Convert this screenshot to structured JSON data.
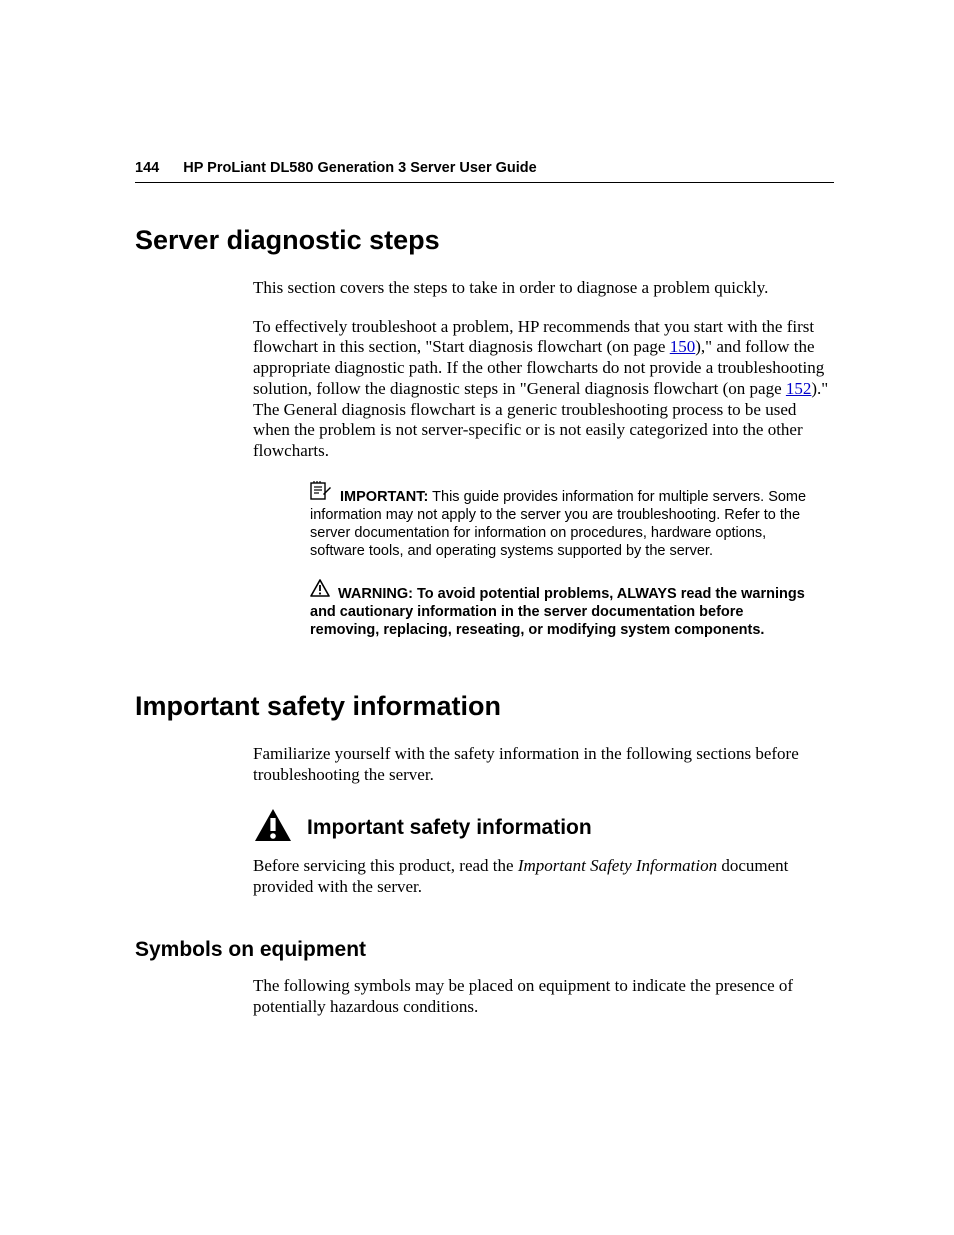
{
  "header": {
    "page_number": "144",
    "title": "HP ProLiant DL580 Generation 3 Server User Guide"
  },
  "section1": {
    "title": "Server diagnostic steps",
    "p1": "This section covers the steps to take in order to diagnose a problem quickly.",
    "p2a": "To effectively troubleshoot a problem, HP recommends that you start with the first flowchart in this section, \"Start diagnosis flowchart (on page ",
    "link1": "150",
    "p2b": "),\" and follow the appropriate diagnostic path. If the other flowcharts do not provide a troubleshooting solution, follow the diagnostic steps in \"General diagnosis flowchart (on page ",
    "link2": "152",
    "p2c": ").\" The General diagnosis flowchart is a generic troubleshooting process to be used when the problem is not server-specific or is not easily categorized into the other flowcharts.",
    "important_label": "IMPORTANT:",
    "important_text": " This guide provides information for multiple servers. Some information may not apply to the server you are troubleshooting. Refer to the server documentation for information on procedures, hardware options, software tools, and operating systems supported by the server.",
    "warning_label": "WARNING:",
    "warning_text": " To avoid potential problems, ALWAYS read the warnings and cautionary information in the server documentation before removing, replacing, reseating, or modifying system components."
  },
  "section2": {
    "title": "Important safety information",
    "p1": "Familiarize yourself with the safety information in the following sections before troubleshooting the server.",
    "subhead": "Important safety information",
    "p2a": "Before servicing this product, read the ",
    "p2i": "Important Safety Information",
    "p2b": " document provided with the server."
  },
  "section3": {
    "title": "Symbols on equipment",
    "p1": "The following symbols may be placed on equipment to indicate the presence of potentially hazardous conditions."
  }
}
